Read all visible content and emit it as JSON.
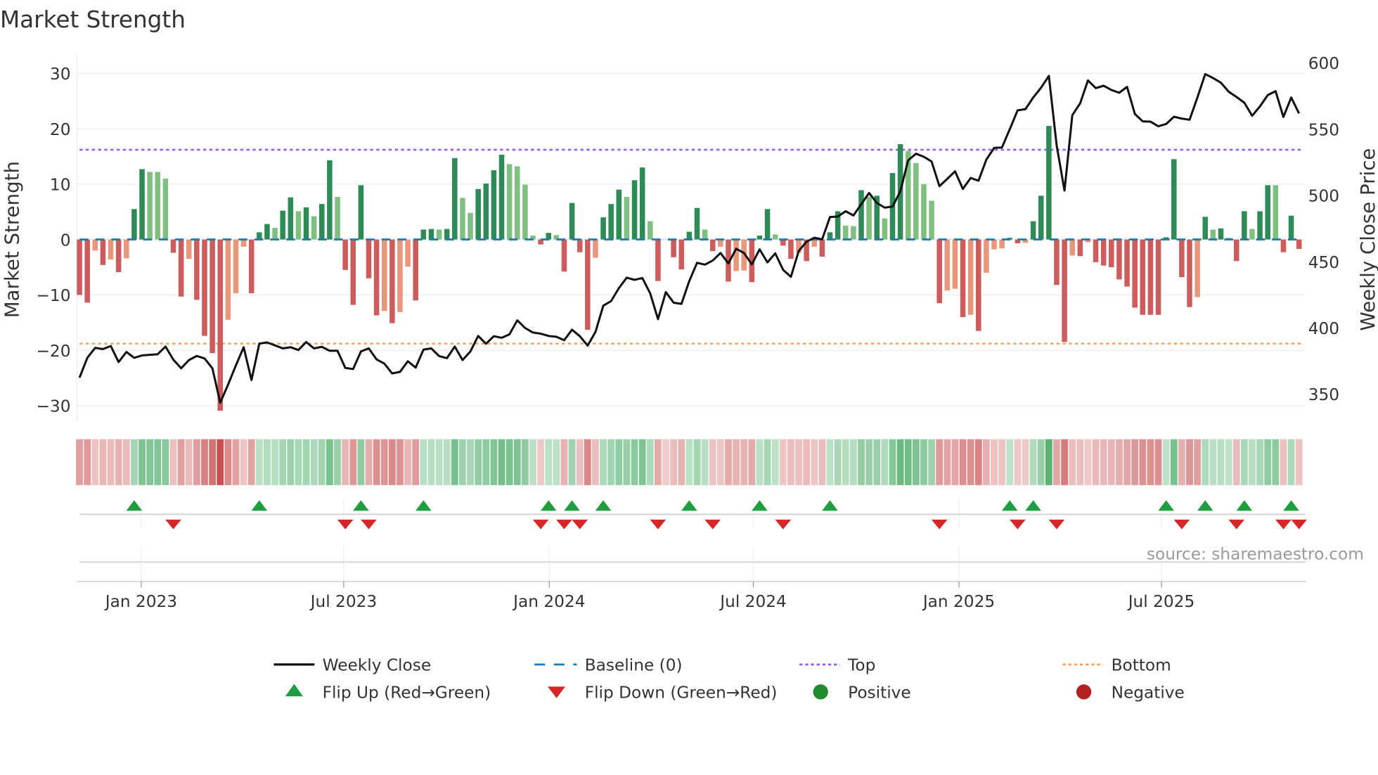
{
  "chart_data": {
    "type": "bar",
    "title": "Market Strength",
    "ylabel": "Market Strength",
    "ylabel_right": "Weekly Close Price",
    "ylim": [
      -33,
      31.5
    ],
    "ylim_right": [
      330,
      608
    ],
    "y_ticks": [
      30,
      20,
      10,
      0,
      -10,
      -20,
      -30
    ],
    "y_tick_labels": [
      "30",
      "20",
      "10",
      "0",
      "−10",
      "−20",
      "−30"
    ],
    "y_right_ticks": [
      600,
      550,
      500,
      450,
      400,
      350
    ],
    "x_unit": "week index",
    "x_ticks": [
      {
        "label": "Jan 2023",
        "x": 7.9
      },
      {
        "label": "Jul 2023",
        "x": 33.8
      },
      {
        "label": "Jan 2024",
        "x": 60.1
      },
      {
        "label": "Jul 2024",
        "x": 86.2
      },
      {
        "label": "Jan 2025",
        "x": 112.5
      },
      {
        "label": "Jul 2025",
        "x": 138.4
      }
    ],
    "top_level": 16.2,
    "bottom_level": -18.8,
    "baseline": 0,
    "grid": true,
    "legend_position": "bottom",
    "series": [
      {
        "name": "Market Strength",
        "type": "bar",
        "values": [
          -10.0,
          -11.4,
          -2.0,
          -4.6,
          -3.6,
          -5.9,
          -3.4,
          5.5,
          12.7,
          12.2,
          12.2,
          11.0,
          -2.4,
          -10.3,
          -3.5,
          -10.9,
          -17.4,
          -20.5,
          -30.9,
          -14.5,
          -9.7,
          -1.3,
          -9.7,
          1.3,
          2.8,
          2.1,
          5.2,
          7.6,
          5.1,
          5.8,
          4.2,
          6.4,
          14.3,
          7.7,
          -5.5,
          -11.8,
          9.8,
          -7.0,
          -13.7,
          -12.9,
          -15.1,
          -13.1,
          -4.9,
          -11.0,
          1.8,
          1.9,
          1.8,
          1.9,
          14.7,
          7.5,
          4.8,
          9.1,
          10.1,
          12.5,
          15.3,
          13.6,
          13.2,
          9.9,
          0.7,
          -0.9,
          1.2,
          0.8,
          -5.8,
          6.6,
          -2.3,
          -16.3,
          -3.3,
          4.0,
          6.4,
          9.0,
          7.7,
          10.7,
          13.0,
          3.3,
          -7.5,
          0,
          -3.2,
          -5.4,
          1.4,
          5.7,
          1.8,
          -2.1,
          -1.3,
          -7.6,
          -5.7,
          -5.6,
          -7.7,
          0.7,
          5.5,
          0.9,
          -1.1,
          -3.5,
          -2.4,
          -3.9,
          -1.3,
          -3.1,
          1.3,
          5.1,
          2.5,
          2.4,
          8.9,
          7.7,
          7.9,
          3.8,
          12.0,
          17.2,
          16.0,
          13.8,
          10.0,
          7.0,
          -11.5,
          -9.2,
          -8.9,
          -14.0,
          -13.6,
          -16.5,
          -6.0,
          -1.8,
          -1.6,
          0.3,
          -0.7,
          -0.6,
          3.3,
          7.9,
          20.5,
          -8.2,
          -18.5,
          -2.9,
          -3.0,
          -0.5,
          -4.1,
          -4.7,
          -5.0,
          -7.2,
          -8.5,
          -12.3,
          -13.6,
          -13.6,
          -13.6,
          0.4,
          14.5,
          -6.8,
          -12.2,
          -10.4,
          4.1,
          1.8,
          2.0,
          0.3,
          -3.9,
          5.1,
          1.9,
          5.1,
          9.8,
          9.8,
          -2.3,
          4.3,
          -1.7
        ]
      },
      {
        "name": "Weekly Close",
        "type": "line",
        "axis": "right",
        "values": [
          362.4,
          377.4,
          384.9,
          384,
          386.3,
          374.2,
          381.8,
          377.4,
          379.2,
          379.7,
          380.1,
          385.9,
          376,
          369.5,
          375.7,
          378.8,
          376.9,
          369.5,
          343.5,
          357.1,
          371.6,
          385.4,
          360.6,
          388.1,
          389,
          386.8,
          384.5,
          385.4,
          383.3,
          389.3,
          384.5,
          385.7,
          382.7,
          382.7,
          369.8,
          368.9,
          382.2,
          384.5,
          376.2,
          373,
          365.6,
          366.8,
          374.8,
          370,
          383.6,
          384.5,
          378.7,
          377.1,
          385.9,
          375.7,
          382.2,
          393.9,
          388,
          393.7,
          392.5,
          395.1,
          405.7,
          399.9,
          396.5,
          395.6,
          393.9,
          393.3,
          390.7,
          398.6,
          393.7,
          386.6,
          396.9,
          416.7,
          420.2,
          430,
          437.9,
          436.2,
          437.6,
          426.1,
          406.6,
          427,
          419,
          418.1,
          435.3,
          449.1,
          447.7,
          450.8,
          456.5,
          448.6,
          459.7,
          456.5,
          447.9,
          459.2,
          449.4,
          456.2,
          443.8,
          438.5,
          458,
          465,
          468,
          466.8,
          483.6,
          484,
          488,
          484.8,
          493.3,
          501.8,
          494.2,
          490.7,
          491.5,
          503,
          526.4,
          531.4,
          529.1,
          525.5,
          506.9,
          512.4,
          518.1,
          504.8,
          513.1,
          511,
          526.9,
          535.8,
          536.1,
          549.9,
          564.1,
          565,
          573.8,
          581.2,
          590.1,
          537.5,
          503.6,
          560.5,
          569.4,
          586.7,
          580.9,
          582.7,
          579.5,
          577.4,
          581.8,
          561.4,
          555.8,
          555.6,
          552.1,
          553.8,
          559.3,
          557.9,
          557,
          573.8,
          591.5,
          588.5,
          585,
          578.2,
          574.2,
          569.9,
          560,
          567.1,
          575.6,
          578.6,
          559.1,
          573.8,
          561.8
        ]
      }
    ],
    "legend": [
      {
        "label": "Weekly Close",
        "symbol": "line",
        "color": "#111111"
      },
      {
        "label": "Baseline (0)",
        "symbol": "dashed",
        "color": "#1f77b4"
      },
      {
        "label": "Top",
        "symbol": "dotted",
        "color": "#9b5de5"
      },
      {
        "label": "Bottom",
        "symbol": "dotted",
        "color": "#f4a259"
      },
      {
        "label": "Flip Up (Red→Green)",
        "symbol": "triangle-up",
        "color": "#1f9e3f"
      },
      {
        "label": "Flip Down (Green→Red)",
        "symbol": "triangle-down",
        "color": "#d62728"
      },
      {
        "label": "Positive",
        "symbol": "circle",
        "color": "#1f8a2e"
      },
      {
        "label": "Negative",
        "symbol": "circle",
        "color": "#b22222"
      }
    ],
    "source": "source: sharemaestro.com"
  },
  "colors": {
    "pos_strong": "#2e8b57",
    "pos_weak": "#7fbf7f",
    "neg_strong": "#cd5c5c",
    "neg_weak": "#e9967a",
    "grid": "#ebebeb"
  }
}
